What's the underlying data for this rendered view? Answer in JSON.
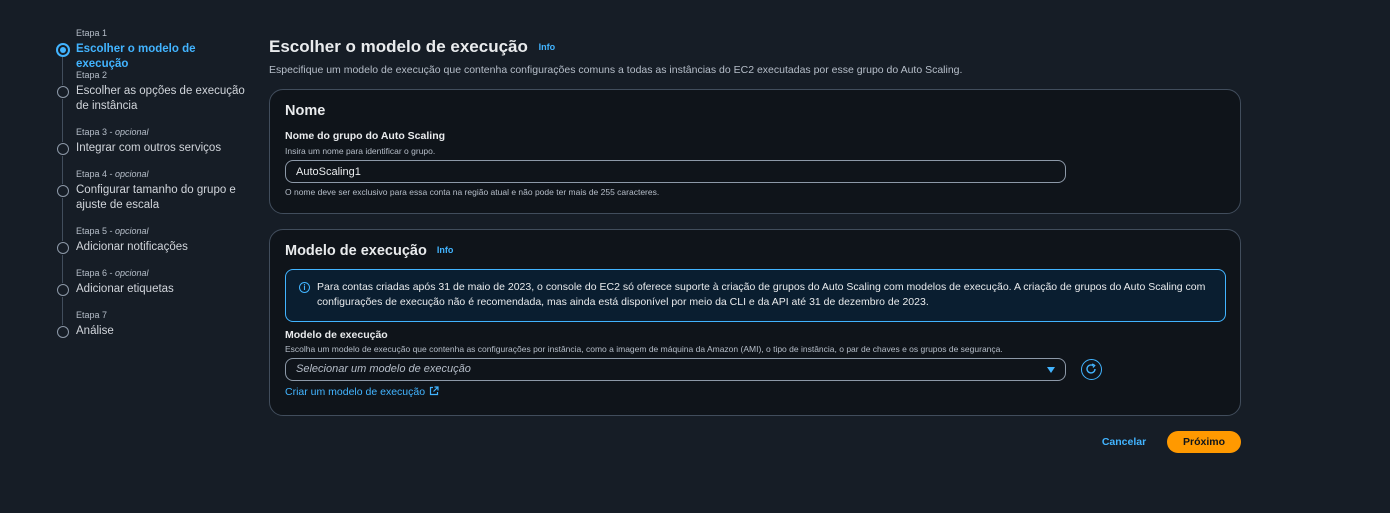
{
  "steps": [
    {
      "num": "Etapa 1",
      "optional": "",
      "label": "Escolher o modelo de execução",
      "active": true
    },
    {
      "num": "Etapa 2",
      "optional": "",
      "label": "Escolher as opções de execução de instância",
      "active": false
    },
    {
      "num": "Etapa 3",
      "optional": "opcional",
      "label": "Integrar com outros serviços",
      "active": false
    },
    {
      "num": "Etapa 4",
      "optional": "opcional",
      "label": "Configurar tamanho do grupo e ajuste de escala",
      "active": false
    },
    {
      "num": "Etapa 5",
      "optional": "opcional",
      "label": "Adicionar notificações",
      "active": false
    },
    {
      "num": "Etapa 6",
      "optional": "opcional",
      "label": "Adicionar etiquetas",
      "active": false
    },
    {
      "num": "Etapa 7",
      "optional": "",
      "label": "Análise",
      "active": false
    }
  ],
  "page": {
    "title": "Escolher o modelo de execução",
    "info": "Info",
    "description": "Especifique um modelo de execução que contenha configurações comuns a todas as instâncias do EC2 executadas por esse grupo do Auto Scaling."
  },
  "name_card": {
    "title": "Nome",
    "field_label": "Nome do grupo do Auto Scaling",
    "field_desc": "Insira um nome para identificar o grupo.",
    "value": "AutoScaling1",
    "constraint": "O nome deve ser exclusivo para essa conta na região atual e não pode ter mais de 255 caracteres."
  },
  "template_card": {
    "title": "Modelo de execução",
    "info": "Info",
    "alert_text": "Para contas criadas após 31 de maio de 2023, o console do EC2 só oferece suporte à criação de grupos do Auto Scaling com modelos de execução. A criação de grupos do Auto Scaling com configurações de execução não é recomendada, mas ainda está disponível por meio da CLI e da API até 31 de dezembro de 2023.",
    "field_label": "Modelo de execução",
    "field_desc": "Escolha um modelo de execução que contenha as configurações por instância, como a imagem de máquina da Amazon (AMI), o tipo de instância, o par de chaves e os grupos de segurança.",
    "select_placeholder": "Selecionar um modelo de execução",
    "create_link": "Criar um modelo de execução"
  },
  "actions": {
    "cancel": "Cancelar",
    "next": "Próximo"
  },
  "colors": {
    "accent": "#42b4ff",
    "primary_button": "#ff9900",
    "background": "#161d26",
    "card": "#0f141a"
  }
}
